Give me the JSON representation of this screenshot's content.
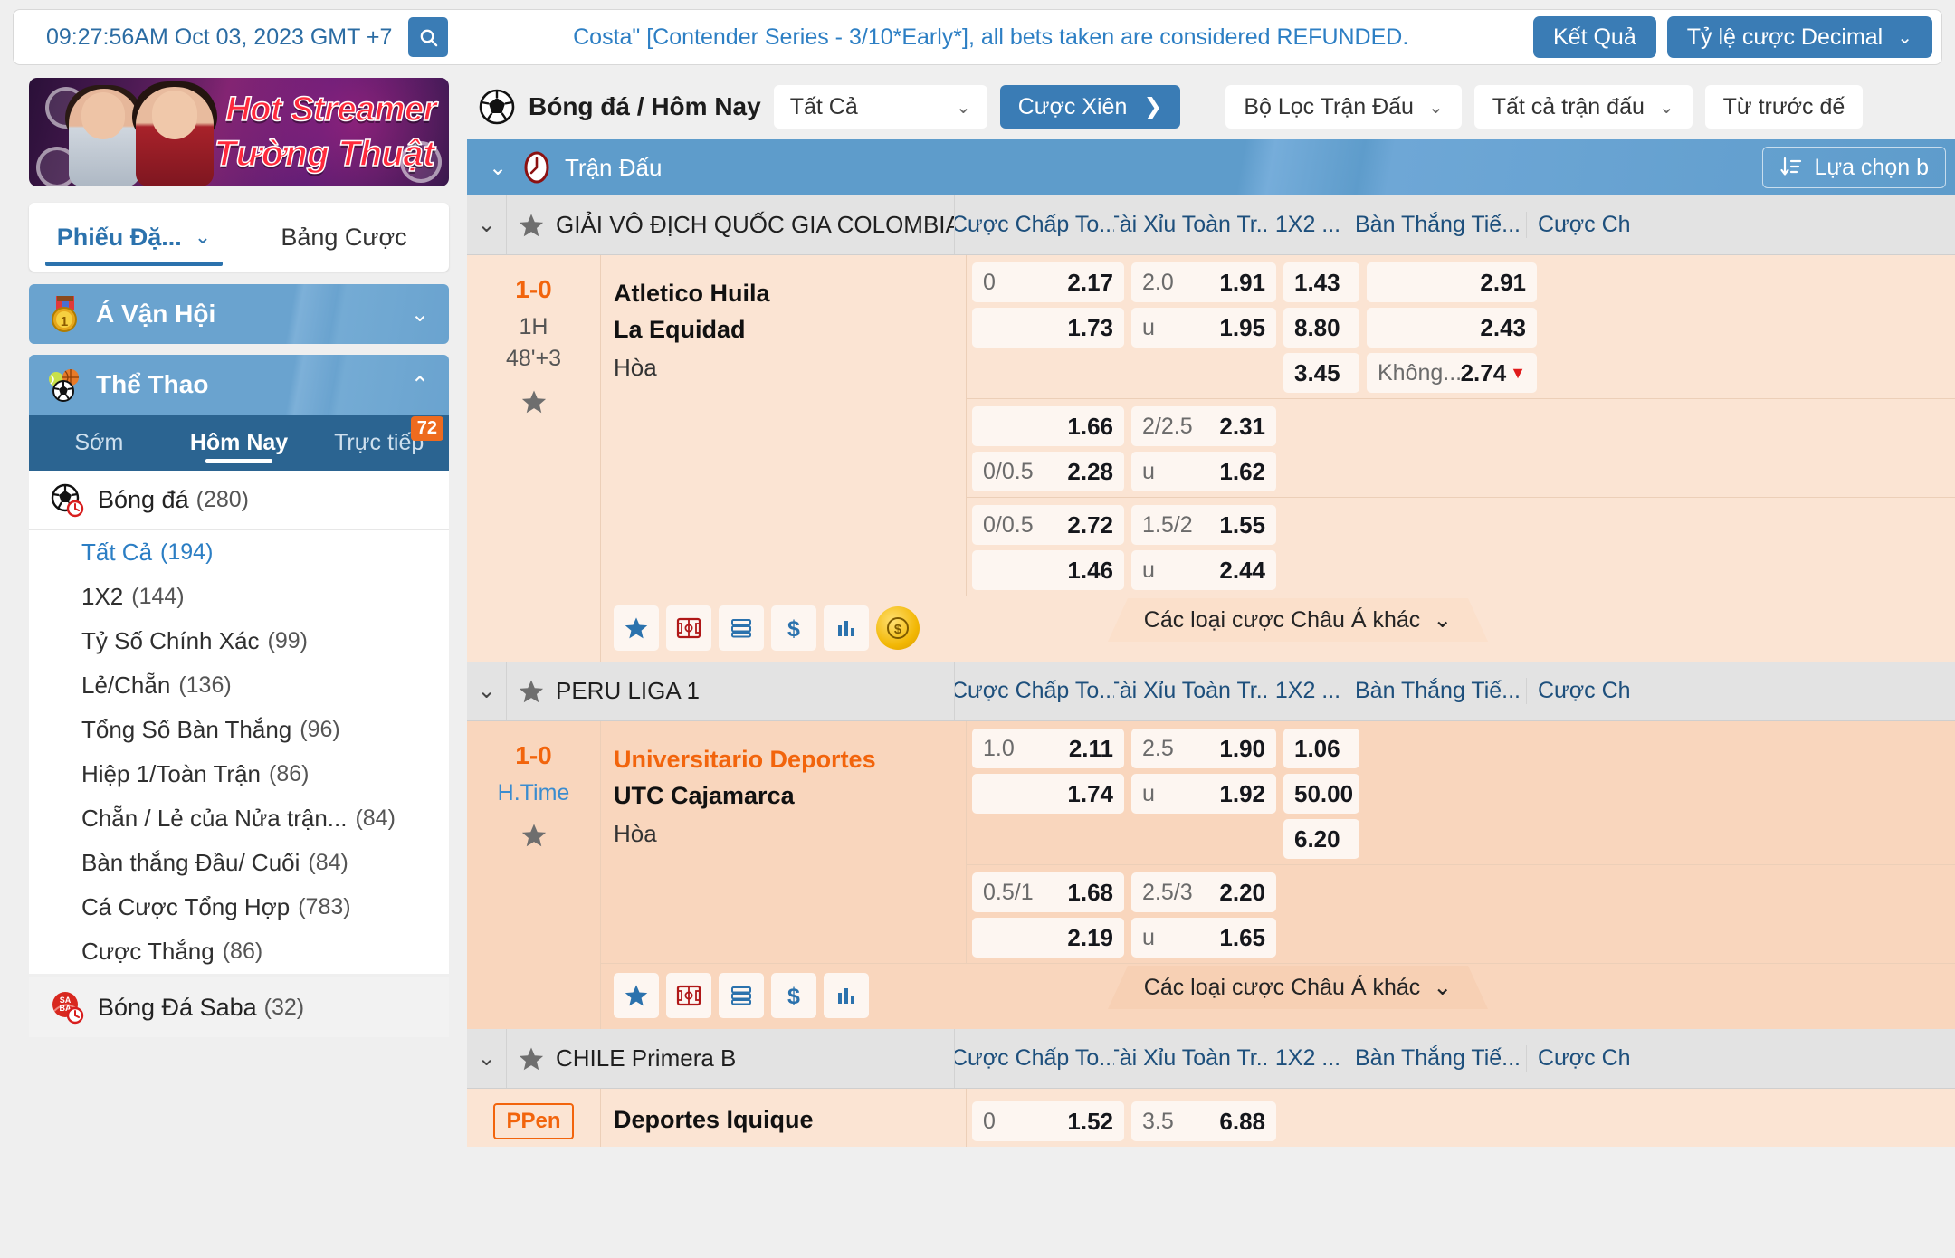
{
  "topbar": {
    "clock": "09:27:56AM Oct 03, 2023 GMT +7",
    "search_icon": "search-icon",
    "marquee": "Costa\" [Contender Series - 3/10*Early*], all bets taken are considered REFUNDED.",
    "results_button": "Kết Quả",
    "odds_format_button": "Tỷ lệ cược Decimal",
    "odds_format_caret": "⌄"
  },
  "sidebar": {
    "promo": {
      "line1": "Hot Streamer",
      "line2": "Tường Thuật"
    },
    "betslip": {
      "tab_active": "Phiếu Đặ...",
      "tab_active_caret": "⌄",
      "tab_other": "Bảng Cược"
    },
    "sections": [
      {
        "label": "Á Vận Hội",
        "icon": "medal-icon",
        "chevron": "⌄"
      },
      {
        "label": "Thể Thao",
        "icon": "sports-balls-icon",
        "chevron": "⌃"
      }
    ],
    "tabs": [
      {
        "label": "Sớm",
        "active": false
      },
      {
        "label": "Hôm Nay",
        "active": true
      },
      {
        "label": "Trực tiếp",
        "active": false,
        "badge": "72"
      }
    ],
    "sport": {
      "name": "Bóng đá",
      "count": "(280)",
      "icon": "football-clock-icon"
    },
    "subitems": [
      {
        "label": "Tất Cả",
        "count": "(194)",
        "selected": true
      },
      {
        "label": "1X2",
        "count": "(144)",
        "selected": false
      },
      {
        "label": "Tỷ Số Chính Xác",
        "count": "(99)",
        "selected": false
      },
      {
        "label": "Lẻ/Chẵn",
        "count": "(136)",
        "selected": false
      },
      {
        "label": "Tổng Số Bàn Thắng",
        "count": "(96)",
        "selected": false
      },
      {
        "label": "Hiệp 1/Toàn Trận",
        "count": "(86)",
        "selected": false
      },
      {
        "label": "Chẵn / Lẻ của Nửa trận...",
        "count": "(84)",
        "selected": false
      },
      {
        "label": "Bàn thắng Đầu/ Cuối",
        "count": "(84)",
        "selected": false
      },
      {
        "label": "Cá Cược Tổng Hợp",
        "count": "(783)",
        "selected": false
      },
      {
        "label": "Cược Thắng",
        "count": "(86)",
        "selected": false
      }
    ],
    "sport2": {
      "name": "Bóng Đá Saba",
      "count": "(32)",
      "icon": "saba-clock-icon"
    }
  },
  "main": {
    "toolbar": {
      "sport_icon": "football-icon",
      "title": "Bóng đá / Hôm Nay",
      "all_select": "Tất Cả",
      "all_select_caret": "⌄",
      "parlay_button": "Cược Xiên",
      "parlay_arrow": "❯",
      "filter_match": "Bộ Lọc Trận Đấu",
      "filter_match_caret": "⌄",
      "all_matches": "Tất cả trận đấu",
      "all_matches_caret": "⌄",
      "time_filter": "Từ trước đế",
      "time_filter_caret": "⌄"
    },
    "blue_band": {
      "chevron": "⌄",
      "clock_icon": "clock-icon",
      "label": "Trận Đấu",
      "select_bets_icon": "sort-icon",
      "select_bets_label": "Lựa chọn b"
    },
    "column_headers": [
      "Cược Chấp To...",
      "Tài Xỉu Toàn Tr...",
      "1X2 ...",
      "Bàn Thắng Tiế...",
      "Cược Ch"
    ],
    "more_asia_label": "Các loại cược Châu Á khác",
    "more_asia_caret": "⌄",
    "footer_icons": [
      "star-icon",
      "pitch-icon",
      "stack-icon",
      "dollar-icon",
      "stats-icon",
      "cashout-coin-icon"
    ],
    "leagues": [
      {
        "name": "GIẢI VÔ ĐỊCH QUỐC GIA COLOMBIA",
        "chevron": "⌄",
        "star_icon": "star-icon",
        "matches": [
          {
            "score": "1-0",
            "period": "1H",
            "clock": "48'+3",
            "star_icon": "star-icon",
            "home": "Atletico Huila",
            "away": "La Equidad",
            "draw": "Hòa",
            "home_highlight": false,
            "blocks": [
              {
                "handicap": [
                  {
                    "hdp": "0",
                    "odd": "2.17"
                  },
                  {
                    "hdp": "",
                    "odd": "1.73"
                  }
                ],
                "overunder": [
                  {
                    "hdp": "2.0",
                    "odd": "1.91"
                  },
                  {
                    "hdp": "u",
                    "odd": "1.95"
                  }
                ],
                "onextwo": [
                  {
                    "odd": "1.43"
                  },
                  {
                    "odd": "8.80"
                  },
                  {
                    "odd": "3.45"
                  }
                ],
                "nextgoal": [
                  {
                    "label": "",
                    "odd": "2.91"
                  },
                  {
                    "label": "",
                    "odd": "2.43"
                  },
                  {
                    "label": "Không...",
                    "odd": "2.74",
                    "down": true
                  }
                ]
              },
              {
                "handicap": [
                  {
                    "hdp": "",
                    "odd": "1.66"
                  },
                  {
                    "hdp": "0/0.5",
                    "odd": "2.28"
                  }
                ],
                "overunder": [
                  {
                    "hdp": "2/2.5",
                    "odd": "2.31"
                  },
                  {
                    "hdp": "u",
                    "odd": "1.62"
                  }
                ],
                "onextwo": [],
                "nextgoal": []
              },
              {
                "handicap": [
                  {
                    "hdp": "0/0.5",
                    "odd": "2.72"
                  },
                  {
                    "hdp": "",
                    "odd": "1.46"
                  }
                ],
                "overunder": [
                  {
                    "hdp": "1.5/2",
                    "odd": "1.55"
                  },
                  {
                    "hdp": "u",
                    "odd": "2.44"
                  }
                ],
                "onextwo": [],
                "nextgoal": []
              }
            ],
            "has_coin": true
          }
        ]
      },
      {
        "name": "PERU LIGA 1",
        "chevron": "⌄",
        "star_icon": "star-icon",
        "matches": [
          {
            "score": "1-0",
            "period": "H.Time",
            "clock": "",
            "star_icon": "star-icon",
            "home": "Universitario Deportes",
            "away": "UTC Cajamarca",
            "draw": "Hòa",
            "home_highlight": true,
            "blocks": [
              {
                "handicap": [
                  {
                    "hdp": "1.0",
                    "odd": "2.11"
                  },
                  {
                    "hdp": "",
                    "odd": "1.74"
                  }
                ],
                "overunder": [
                  {
                    "hdp": "2.5",
                    "odd": "1.90"
                  },
                  {
                    "hdp": "u",
                    "odd": "1.92"
                  }
                ],
                "onextwo": [
                  {
                    "odd": "1.06"
                  },
                  {
                    "odd": "50.00"
                  },
                  {
                    "odd": "6.20"
                  }
                ],
                "nextgoal": []
              },
              {
                "handicap": [
                  {
                    "hdp": "0.5/1",
                    "odd": "1.68"
                  },
                  {
                    "hdp": "",
                    "odd": "2.19"
                  }
                ],
                "overunder": [
                  {
                    "hdp": "2.5/3",
                    "odd": "2.20"
                  },
                  {
                    "hdp": "u",
                    "odd": "1.65"
                  }
                ],
                "onextwo": [],
                "nextgoal": []
              }
            ],
            "has_coin": false
          }
        ]
      },
      {
        "name": "CHILE Primera B",
        "chevron": "⌄",
        "star_icon": "star-icon",
        "matches": [
          {
            "score": "PPen",
            "period": "",
            "clock": "",
            "star_icon": "star-icon",
            "home": "Deportes Iquique",
            "away": "",
            "draw": "",
            "home_highlight": false,
            "blocks": [
              {
                "handicap": [
                  {
                    "hdp": "0",
                    "odd": "1.52"
                  }
                ],
                "overunder": [
                  {
                    "hdp": "3.5",
                    "odd": "6.88"
                  }
                ],
                "onextwo": [],
                "nextgoal": []
              }
            ],
            "has_coin": false
          }
        ]
      }
    ]
  }
}
